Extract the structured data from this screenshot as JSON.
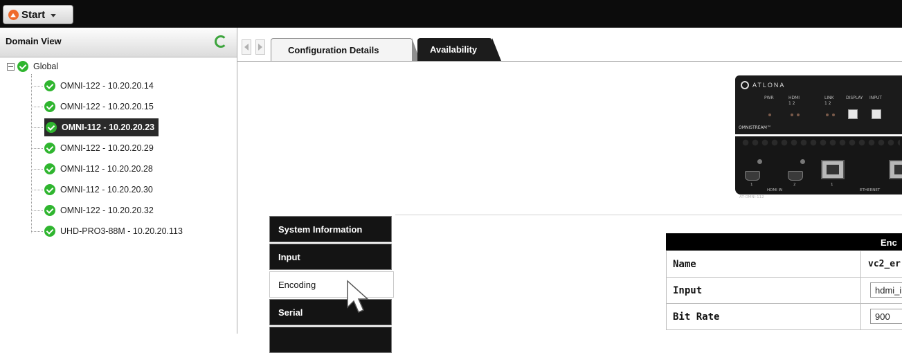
{
  "topbar": {
    "start_label": "Start"
  },
  "domain_view": {
    "title": "Domain View",
    "root": "Global",
    "devices": [
      "OMNI-122 - 10.20.20.14",
      "OMNI-122 - 10.20.20.15",
      "OMNI-112 - 10.20.20.23",
      "OMNI-122 - 10.20.20.29",
      "OMNI-112 - 10.20.20.28",
      "OMNI-112 - 10.20.20.30",
      "OMNI-122 - 10.20.20.32",
      "UHD-PRO3-88M - 10.20.20.113"
    ],
    "selected_index": 2
  },
  "tabs": [
    {
      "label": "Configuration Details",
      "active": false
    },
    {
      "label": "Availability",
      "active": true
    }
  ],
  "device_image": {
    "brand": "ATLONA",
    "labels": {
      "pwr": "PWR",
      "hdmi": "HDMI",
      "link": "LINK",
      "display": "DISPLAY",
      "input": "INPUT",
      "ch": "1   2",
      "series": "OMNISTREAM™",
      "hdmi_in": "HDMI IN",
      "ethernet": "ETHERNET",
      "model": "AT-OMNI-112",
      "port1": "1",
      "port2": "2"
    }
  },
  "side_menu": [
    {
      "label": "System Information",
      "style": "dark"
    },
    {
      "label": "Input",
      "style": "dark"
    },
    {
      "label": "Encoding",
      "style": "light"
    },
    {
      "label": "Serial",
      "style": "dark"
    }
  ],
  "encoding_table": {
    "header": "Enc",
    "rows": [
      {
        "key": "Name",
        "value": "vc2_er",
        "type": "text"
      },
      {
        "key": "Input",
        "value": "hdmi_i",
        "type": "field"
      },
      {
        "key": "Bit Rate",
        "value": "900",
        "type": "field"
      }
    ]
  },
  "colors": {
    "ok_green": "#2fb52f",
    "start_orange": "#ef6a2b",
    "dark": "#141414"
  }
}
